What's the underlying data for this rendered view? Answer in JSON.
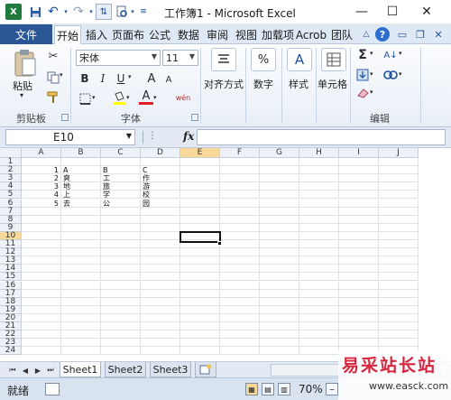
{
  "window": {
    "title": "工作簿1 - Microsoft Excel",
    "app_icon": "excel-icon",
    "controls": [
      "minimize-icon",
      "maximize-icon",
      "close-icon"
    ]
  },
  "quick_access": [
    "save-icon",
    "undo-icon",
    "redo-icon",
    "sort-icon",
    "print-preview-icon",
    "customize-icon"
  ],
  "tabs": [
    "文件",
    "开始",
    "插入",
    "页面布",
    "公式",
    "数据",
    "审阅",
    "视图",
    "加载项",
    "Acrob",
    "团队"
  ],
  "active_tab": "开始",
  "tab_row_icons": [
    "minimize-ribbon-icon",
    "help-icon",
    "window-minimize-icon",
    "window-restore-icon",
    "window-close-icon"
  ],
  "ribbon": {
    "clipboard": {
      "label": "剪贴板",
      "paste_label": "粘贴",
      "icons": [
        "paste-icon",
        "cut-icon",
        "copy-icon",
        "format-painter-icon"
      ]
    },
    "font": {
      "label": "字体",
      "font_name": "宋体",
      "font_size": "11",
      "bold": "B",
      "italic": "I",
      "underline": "U",
      "grow": "A",
      "shrink": "A",
      "font_color_letter": "A",
      "phonetic": "wén",
      "icons": [
        "border-icon",
        "fill-color-icon",
        "font-color-icon",
        "phonetic-icon"
      ]
    },
    "alignment": {
      "label": "对齐方式",
      "icon": "align-icon"
    },
    "number": {
      "label": "数字",
      "icon": "percent-icon",
      "glyph": "%"
    },
    "styles": {
      "label": "样式",
      "icon": "styles-icon",
      "glyph": "A"
    },
    "cells": {
      "label": "单元格",
      "icon": "cells-icon"
    },
    "editing": {
      "label": "编辑",
      "icons": [
        "autosum-icon",
        "sort-filter-icon",
        "fill-icon",
        "find-icon",
        "clear-icon"
      ]
    }
  },
  "formula_bar": {
    "name_box": "E10",
    "fx": "fx",
    "formula": ""
  },
  "grid": {
    "columns": [
      "A",
      "B",
      "C",
      "D",
      "E",
      "F",
      "G",
      "H",
      "I",
      "J"
    ],
    "rows": [
      "1",
      "2",
      "3",
      "4",
      "5",
      "6",
      "7",
      "8",
      "9",
      "10",
      "11",
      "12",
      "13",
      "14",
      "15",
      "16",
      "17",
      "18",
      "19",
      "20",
      "21",
      "22",
      "23",
      "24"
    ],
    "selected_column": "E",
    "selected_row": "10",
    "cells": [
      {
        "ref": "A2",
        "value": "1"
      },
      {
        "ref": "B2",
        "value": "A"
      },
      {
        "ref": "C2",
        "value": "B"
      },
      {
        "ref": "D2",
        "value": "C"
      },
      {
        "ref": "A3",
        "value": "2"
      },
      {
        "ref": "B3",
        "value": "爽"
      },
      {
        "ref": "C3",
        "value": "工"
      },
      {
        "ref": "D3",
        "value": "作"
      },
      {
        "ref": "A4",
        "value": "3"
      },
      {
        "ref": "B4",
        "value": "地"
      },
      {
        "ref": "C4",
        "value": "旅"
      },
      {
        "ref": "D4",
        "value": "游"
      },
      {
        "ref": "A5",
        "value": "4"
      },
      {
        "ref": "B5",
        "value": "上"
      },
      {
        "ref": "C5",
        "value": "学"
      },
      {
        "ref": "D5",
        "value": "校"
      },
      {
        "ref": "A6",
        "value": "5"
      },
      {
        "ref": "B6",
        "value": "去"
      },
      {
        "ref": "C6",
        "value": "公"
      },
      {
        "ref": "D6",
        "value": "园"
      }
    ]
  },
  "sheets": [
    "Sheet1",
    "Sheet2",
    "Sheet3"
  ],
  "active_sheet": "Sheet1",
  "status": {
    "text": "就绪",
    "zoom": "70%"
  },
  "watermark": {
    "text": "易采站长站",
    "url": "www.easck.com"
  },
  "colors": {
    "file_tab": "#2b5797",
    "selected_header": "#f9d99a",
    "watermark": "#d7263d"
  }
}
